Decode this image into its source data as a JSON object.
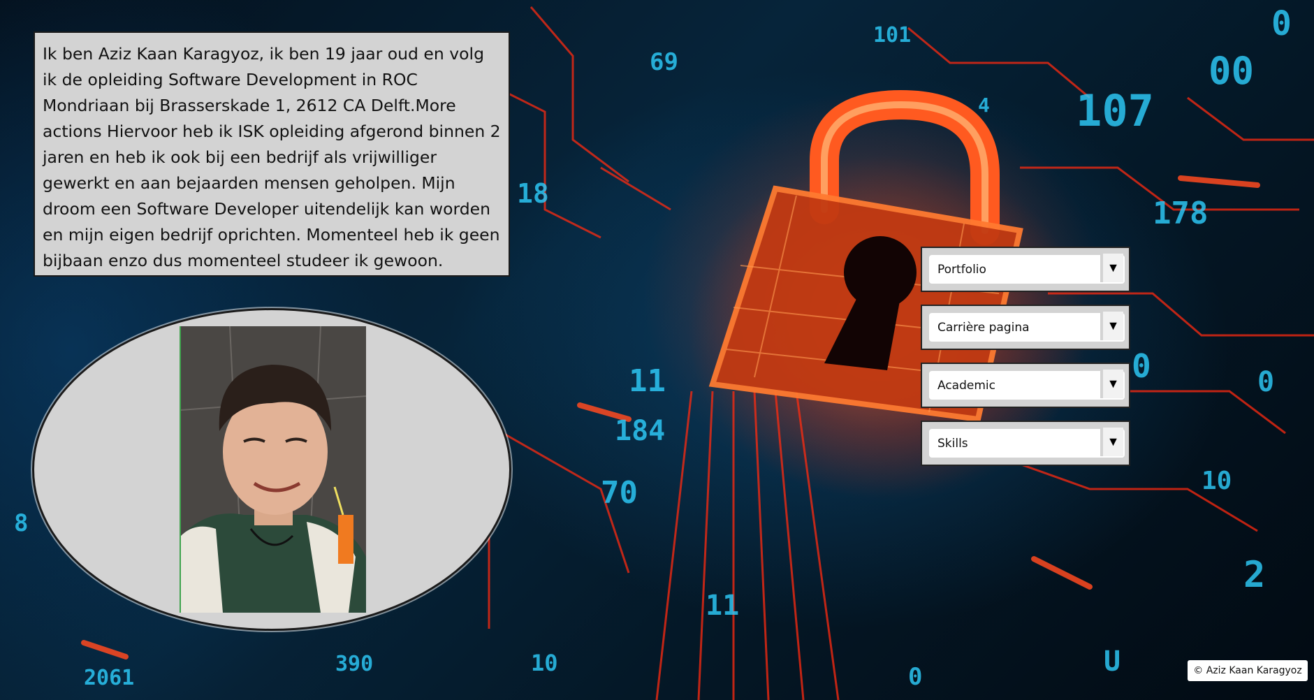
{
  "about": {
    "text": "Ik ben Aziz Kaan Karagyoz, ik ben 19 jaar oud en volg ik de opleiding Software Development in ROC Mondriaan bij Brasserskade 1, 2612 CA Delft.More actions Hiervoor heb ik ISK opleiding afgerond binnen 2 jaren en heb ik ook bij een bedrijf als vrijwilliger gewerkt en aan bejaarden mensen geholpen. Mijn droom een Software Developer uitendelijk kan worden en mijn eigen bedrijf oprichten. Momenteel heb ik geen bijbaan enzo dus momenteel studeer ik gewoon."
  },
  "nav": {
    "items": [
      {
        "label": "Portfolio"
      },
      {
        "label": "Carrière pagina"
      },
      {
        "label": "Academic"
      },
      {
        "label": "Skills"
      }
    ],
    "arrow": "▼"
  },
  "footer": {
    "copyright": "© Aziz Kaan Karagyoz"
  },
  "colors": {
    "panel": "#d3d3d3",
    "accent_red": "#ff3b1a",
    "accent_blue": "#29c8ff"
  }
}
